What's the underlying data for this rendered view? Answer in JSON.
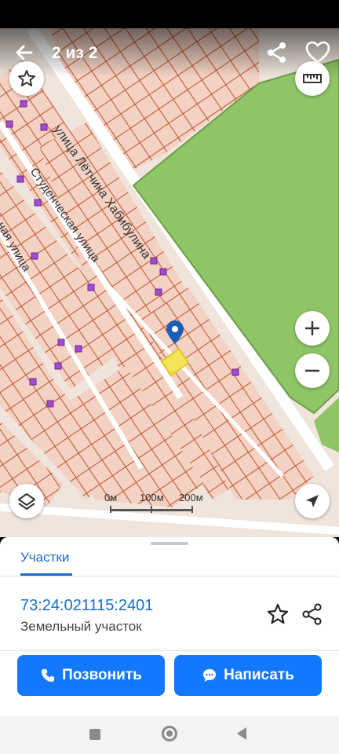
{
  "header": {
    "counter": "2 из 2",
    "back_icon": "arrow-left-icon",
    "share_icon": "share-icon",
    "favorite_icon": "heart-outline-icon"
  },
  "map": {
    "streets": [
      "улица Лётчика Хабибулина",
      "Студенческая улица",
      "ная улица"
    ],
    "scale": {
      "labels": [
        "0м",
        "100м",
        "200м"
      ]
    },
    "controls": {
      "favorite": "star-outline-icon",
      "ruler": "ruler-icon",
      "zoom_in": "plus-icon",
      "zoom_out": "minus-icon",
      "layers": "layers-icon",
      "locate": "navigation-arrow-icon"
    },
    "colors": {
      "parcel_fill": "#f3d2c4",
      "parcel_border": "#c0522a",
      "green_area": "#8fc566",
      "selected_parcel": "#f5e45a",
      "marker": "#1a5fb4"
    }
  },
  "sheet": {
    "tab": "Участки",
    "parcel": {
      "cadastral_number": "73:24:021115:2401",
      "type": "Земельный участок"
    }
  },
  "actions": {
    "call": "Позвонить",
    "message": "Написать"
  },
  "colors": {
    "primary": "#1478ff",
    "link": "#1a6fc4"
  }
}
